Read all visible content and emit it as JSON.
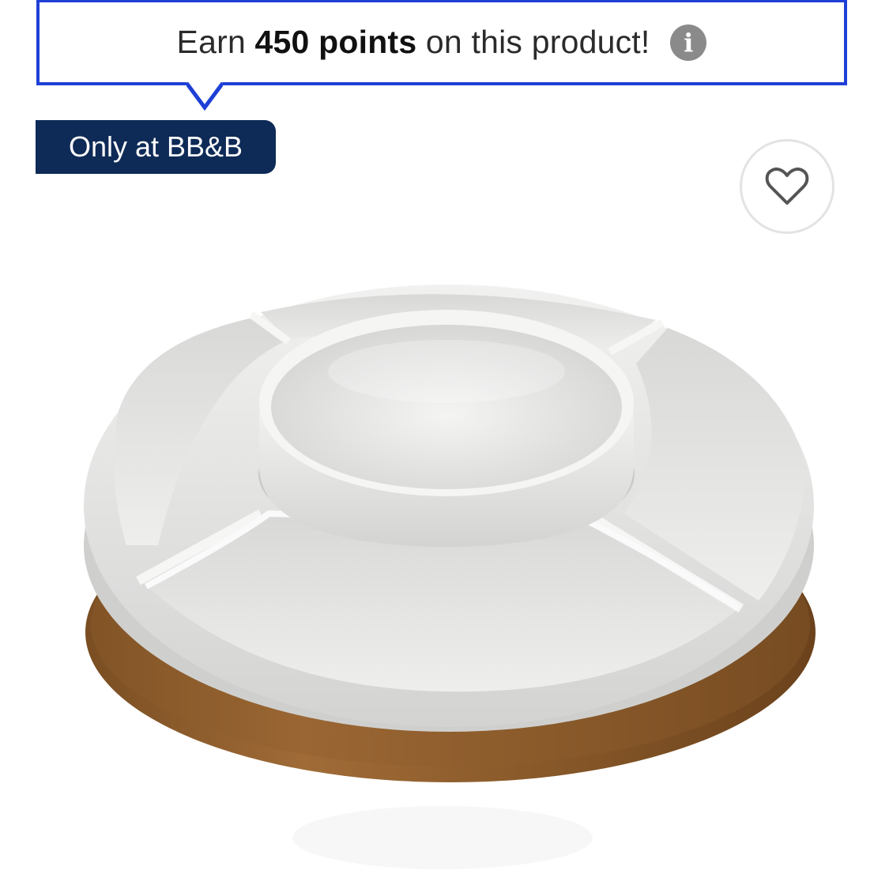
{
  "points_banner": {
    "prefix": "Earn ",
    "points": "450 points",
    "suffix": " on this product!",
    "info_glyph": "i",
    "border_color": "#1f40d6"
  },
  "badge": {
    "label": "Only at BB&B",
    "color": "#0e2a56"
  },
  "favorite": {
    "icon": "heart-outline-icon"
  },
  "product": {
    "image": "white-ceramic-serving-set-on-wood-lazy-susan"
  }
}
